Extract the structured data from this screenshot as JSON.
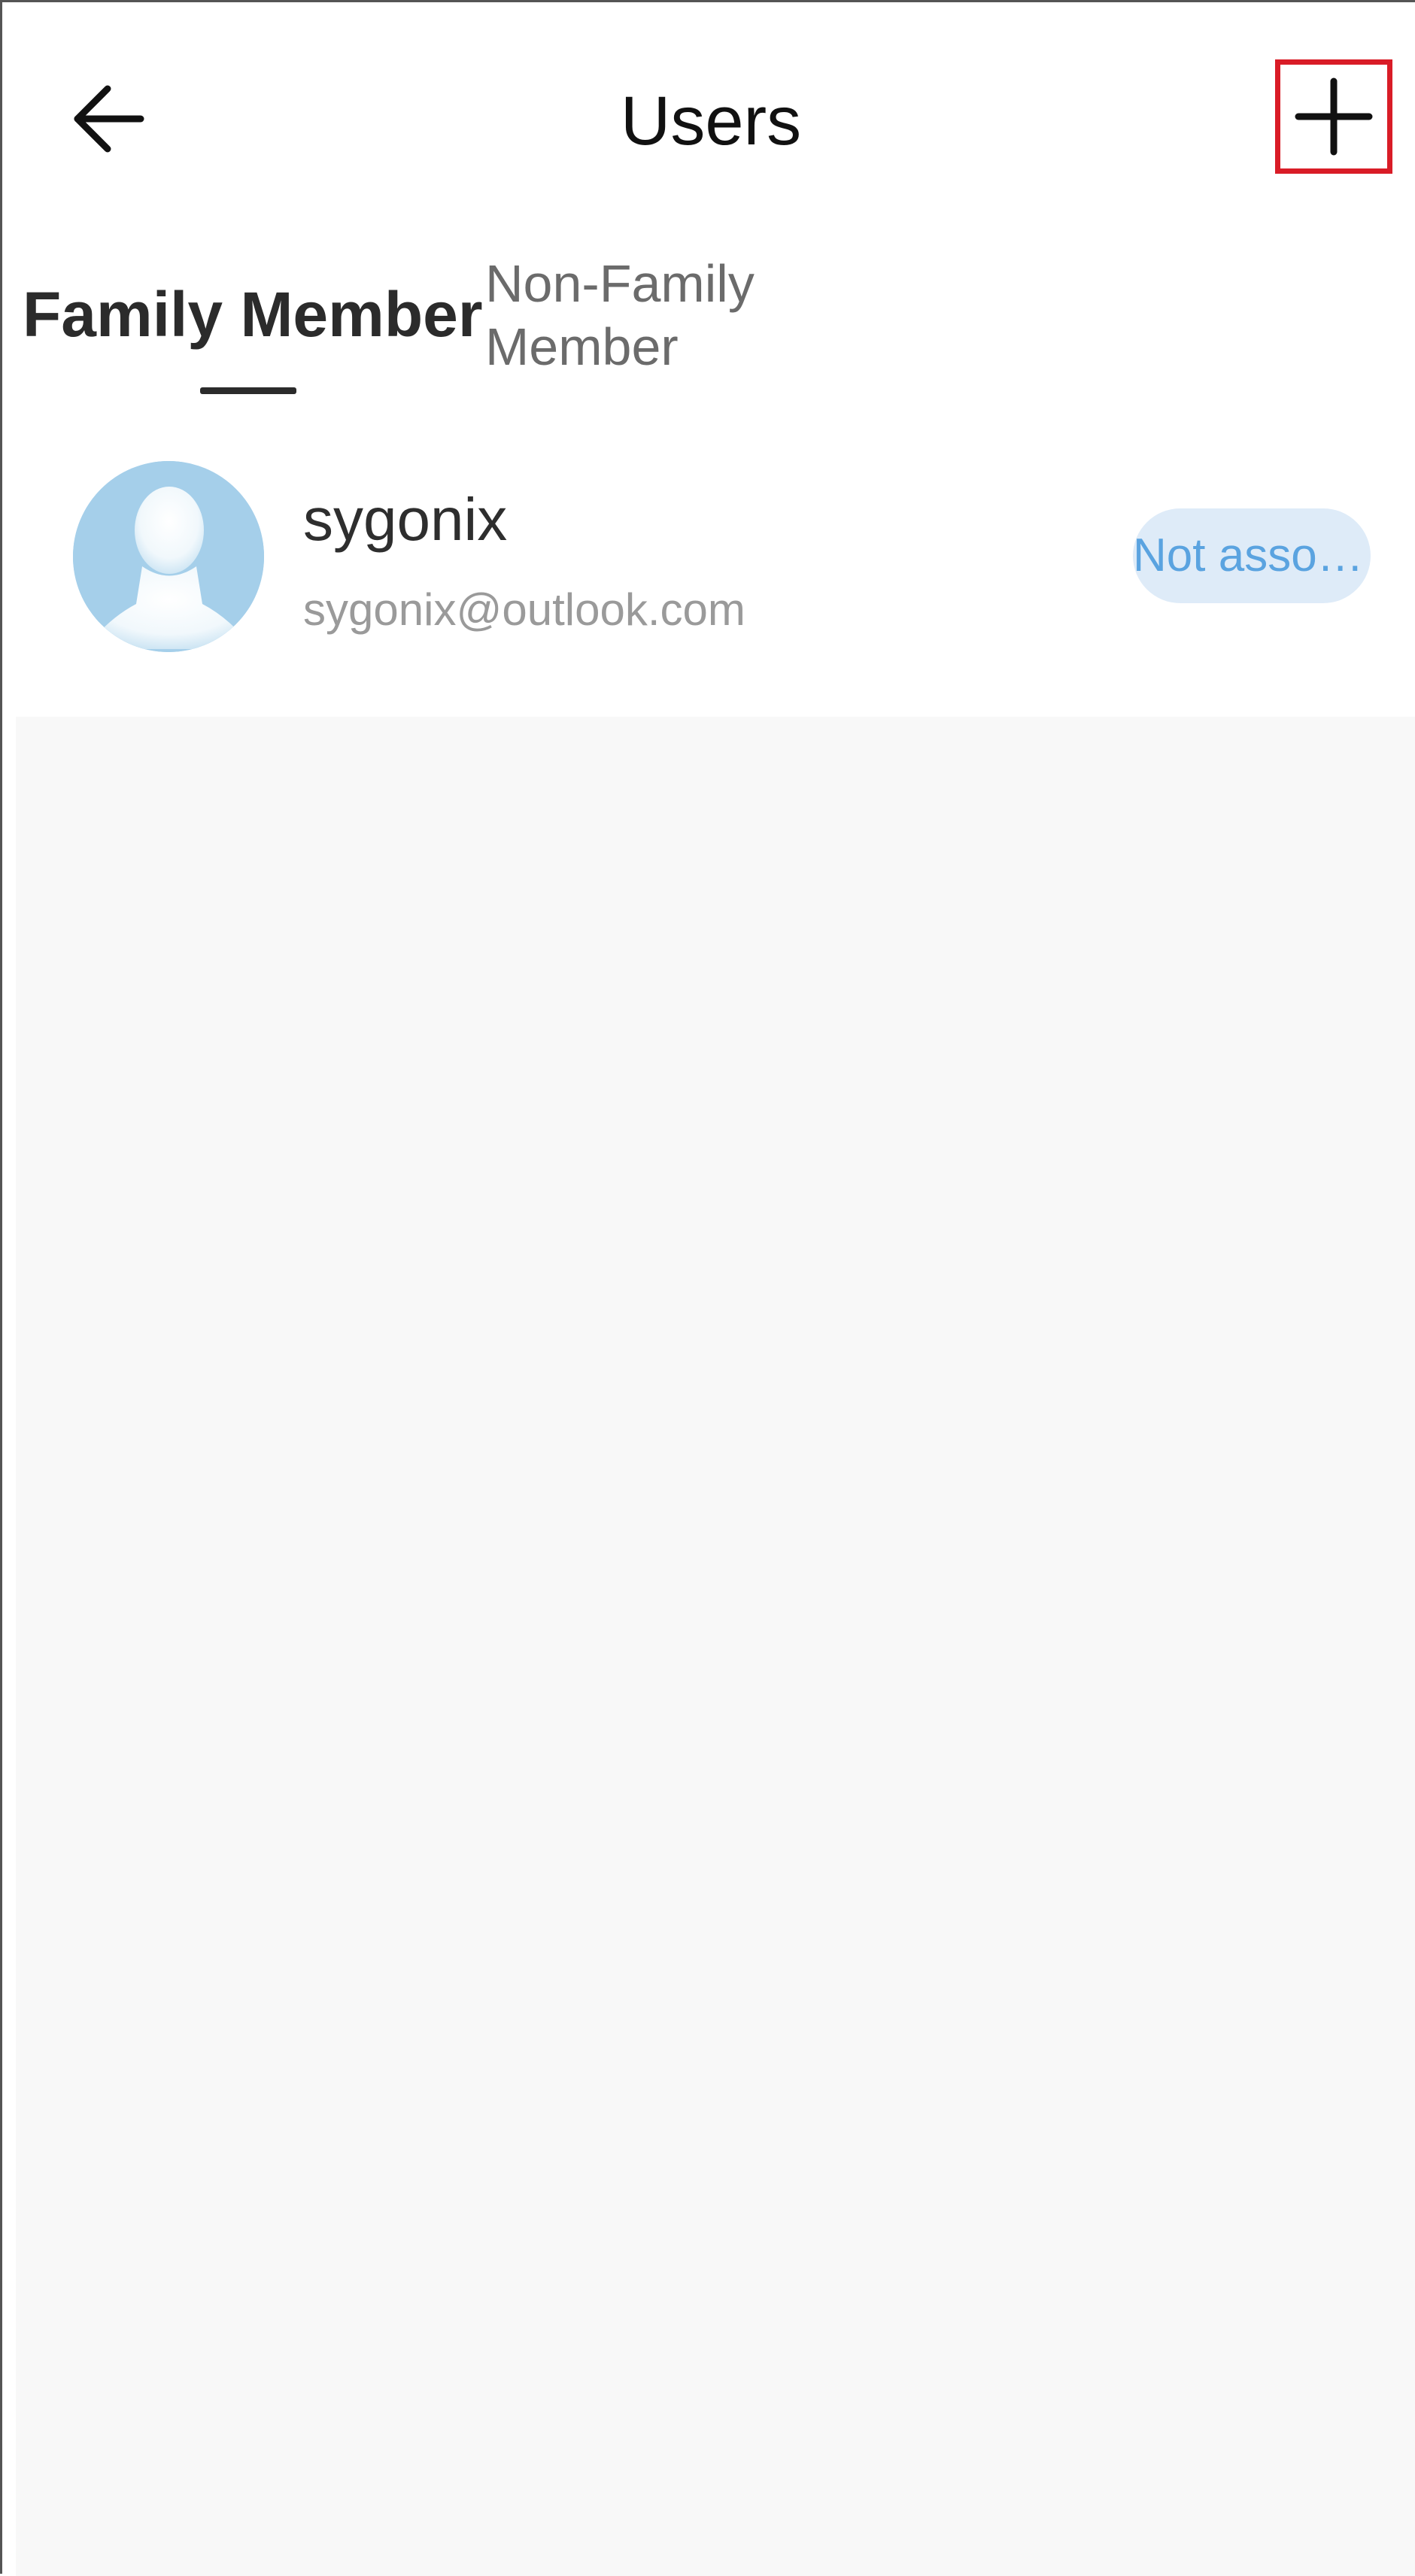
{
  "header": {
    "title": "Users",
    "back_icon": "arrow-left-icon",
    "add_icon": "plus-icon",
    "highlight_color": "#d91c27"
  },
  "tabs": [
    {
      "label": "Family Member",
      "active": true
    },
    {
      "label": "Non-Family Member",
      "active": false
    }
  ],
  "members": [
    {
      "name": "sygonix",
      "email": "sygonix@outlook.com",
      "status": "Not asso…",
      "status_color": "#5aa3e0",
      "avatar_icon": "user-silhouette-icon"
    }
  ]
}
